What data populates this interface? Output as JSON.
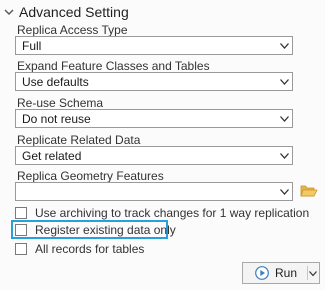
{
  "section": {
    "title": "Advanced Setting",
    "icon": "chevron-down-icon"
  },
  "fields": [
    {
      "label": "Replica Access Type",
      "value": "Full"
    },
    {
      "label": "Expand Feature Classes and Tables",
      "value": "Use defaults"
    },
    {
      "label": "Re-use Schema",
      "value": "Do not reuse"
    },
    {
      "label": "Replicate Related Data",
      "value": "Get related"
    },
    {
      "label": "Replica Geometry Features",
      "value": ""
    }
  ],
  "checkboxes": [
    {
      "label": "Use archiving to track changes for 1 way replication",
      "checked": false
    },
    {
      "label": "Register existing data only",
      "checked": false,
      "highlighted": true
    },
    {
      "label": "All records for tables",
      "checked": false
    }
  ],
  "run_button": {
    "label": "Run",
    "icon": "play-icon"
  },
  "colors": {
    "highlight": "#27a0de",
    "play_icon": "#3a7fc1",
    "folder_icon": "#e7b44a"
  }
}
